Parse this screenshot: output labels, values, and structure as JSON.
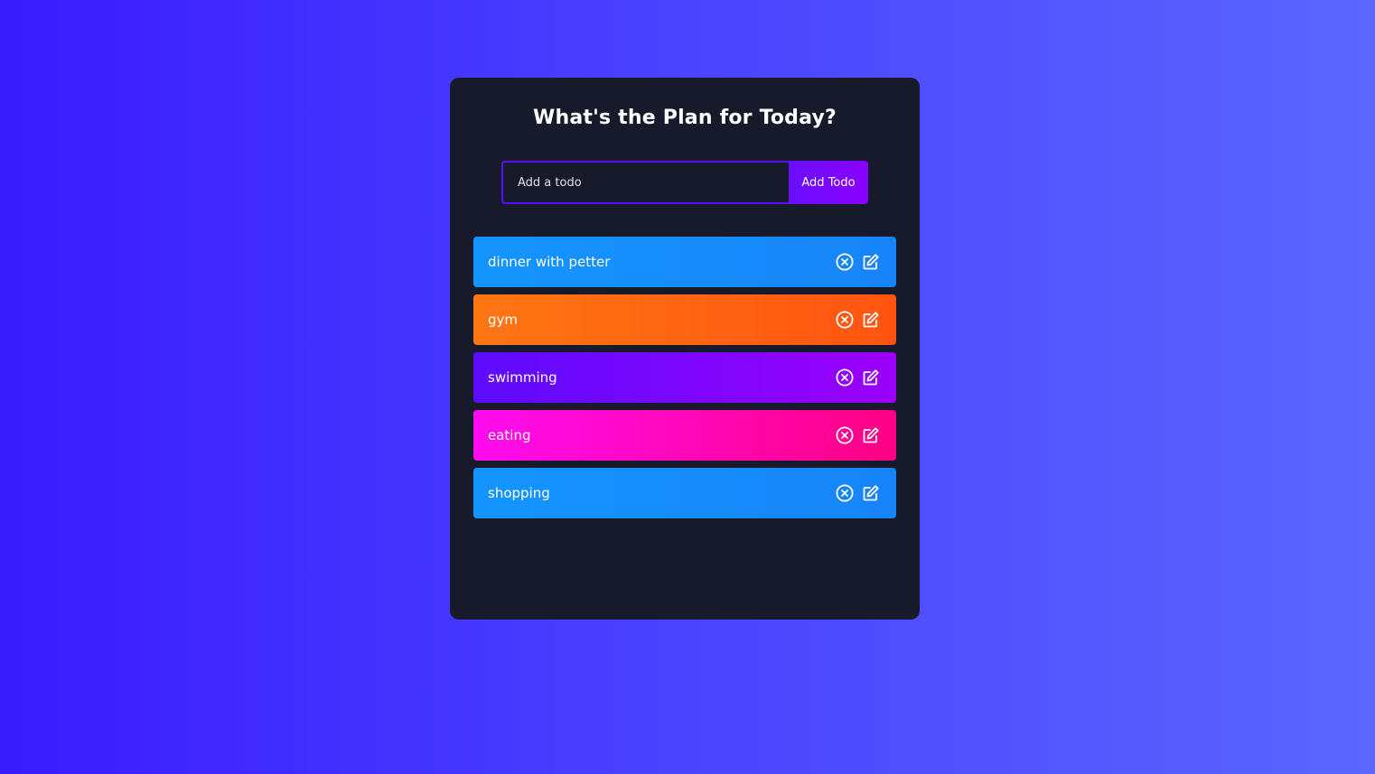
{
  "app": {
    "title": "What's the Plan for Today?"
  },
  "form": {
    "placeholder": "Add a todo",
    "value": "",
    "add_label": "Add Todo"
  },
  "todos": [
    {
      "text": "dinner with petter",
      "colors": [
        "#1595ff",
        "#1784f7"
      ]
    },
    {
      "text": "gym",
      "colors": [
        "#ff7614",
        "#ff5410"
      ]
    },
    {
      "text": "swimming",
      "colors": [
        "#5d0cff",
        "#9b00fa"
      ]
    },
    {
      "text": "eating",
      "colors": [
        "#ff0cf0",
        "#ff0283"
      ]
    },
    {
      "text": "shopping",
      "colors": [
        "#1595ff",
        "#1784f7"
      ]
    }
  ],
  "icons": {
    "delete": "close-circle-icon",
    "edit": "edit-icon"
  },
  "colors": {
    "background": "#3a1cff",
    "card": "#161a2b",
    "accent": "#5d0cff"
  }
}
